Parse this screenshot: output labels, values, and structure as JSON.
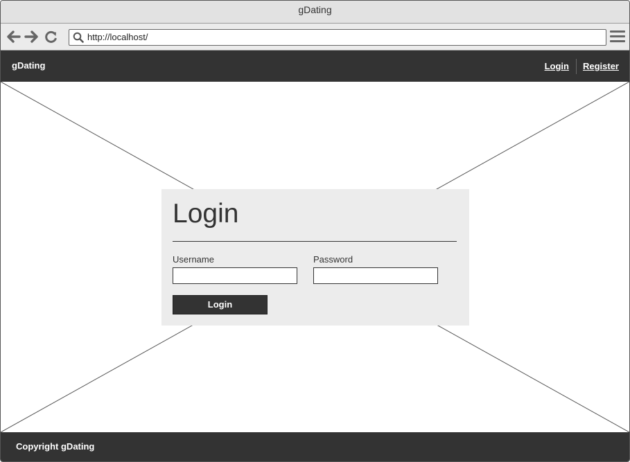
{
  "window": {
    "title": "gDating"
  },
  "browser": {
    "url": "http://localhost/"
  },
  "navbar": {
    "brand": "gDating",
    "links": [
      "Login",
      "Register"
    ]
  },
  "login": {
    "heading": "Login",
    "username_label": "Username",
    "username_value": "",
    "password_label": "Password",
    "password_value": "",
    "submit_label": "Login"
  },
  "footer": {
    "text": "Copyright gDating"
  },
  "icons": {
    "back": "arrow-left-icon",
    "forward": "arrow-right-icon",
    "reload": "reload-icon",
    "search": "search-icon",
    "menu": "hamburger-menu-icon"
  },
  "colors": {
    "navbar": "#333333",
    "footer": "#333333",
    "card": "#ececec",
    "titlebar": "#e2e2e2"
  }
}
